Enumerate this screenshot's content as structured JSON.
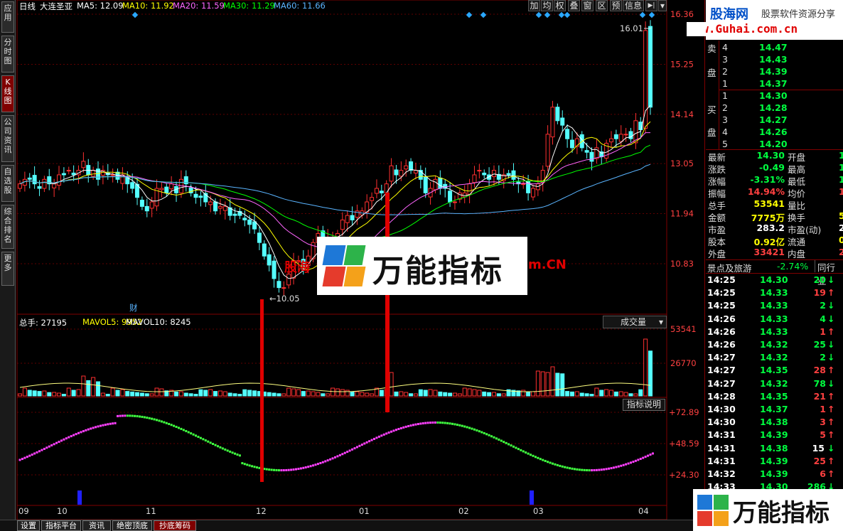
{
  "kline_header": {
    "period": "日线",
    "stock": "大连圣亚",
    "ma5": "MA5: 12.09",
    "ma10": "MA10: 11.92",
    "ma20": "MA20: 11.59",
    "ma30": "MA30: 11.29",
    "ma60": "MA60: 11.66"
  },
  "price_axis": [
    "16.36",
    "15.25",
    "14.14",
    "13.05",
    "11.94",
    "10.83"
  ],
  "price_marks": {
    "high": "16.01",
    "low": "10.05",
    "fin": "财"
  },
  "vol_header": {
    "total": "总手: 27195",
    "mavol5": "MAVOL5: 9952",
    "mavol10": "MAVOL10: 8245",
    "select": "成交量"
  },
  "vol_axis": [
    "53541",
    "26770"
  ],
  "ind_header": {
    "button": "指标说明"
  },
  "ind_axis": [
    "+72.89",
    "+48.59",
    "+24.30"
  ],
  "date_axis": [
    "09",
    "10",
    "11",
    "12",
    "01",
    "02",
    "03",
    "04"
  ],
  "left_tabs": [
    "应用",
    "分时图",
    "K线图",
    "公司资讯",
    "自选股",
    "综合排名",
    "更多"
  ],
  "toolbar": [
    "加",
    "均",
    "权",
    "叠",
    "窗",
    "区",
    "预",
    "信息"
  ],
  "watermarks": {
    "center_text": "万能指标",
    "center_bg_text": "股海",
    "center_suffix": "m.CN",
    "br_text": "万能指标",
    "tr_name": "股海网",
    "tr_slogan": "股票软件资源分享",
    "tr_url": "www.Guhai.com.cn"
  },
  "orderbook": {
    "sell_label": [
      "卖",
      "盘"
    ],
    "buy_label": [
      "买",
      "盘"
    ],
    "sell": [
      {
        "n": "4",
        "p": "14.47"
      },
      {
        "n": "3",
        "p": "14.43"
      },
      {
        "n": "2",
        "p": "14.39"
      },
      {
        "n": "1",
        "p": "14.37"
      }
    ],
    "buy": [
      {
        "n": "1",
        "p": "14.30"
      },
      {
        "n": "2",
        "p": "14.28"
      },
      {
        "n": "3",
        "p": "14.27"
      },
      {
        "n": "4",
        "p": "14.26"
      },
      {
        "n": "5",
        "p": "14.20"
      }
    ]
  },
  "quote": [
    {
      "l": "最新",
      "v": "14.30",
      "l2": "开盘",
      "v2": "1"
    },
    {
      "l": "涨跌",
      "v": "-0.49",
      "l2": "最高",
      "v2": "1"
    },
    {
      "l": "涨幅",
      "v": "-3.31%",
      "l2": "最低",
      "v2": "1"
    },
    {
      "l": "振幅",
      "v": "14.94%",
      "l2": "均价",
      "v2": "1"
    },
    {
      "l": "总手",
      "v": "53541",
      "l2": "量比",
      "v2": ""
    },
    {
      "l": "金额",
      "v": "7775万",
      "l2": "换手",
      "v2": "5"
    },
    {
      "l": "市盈",
      "v": "283.2",
      "l2": "市盈(动)",
      "v2": "2"
    },
    {
      "l": "股本",
      "v": "0.92亿",
      "l2": "流通",
      "v2": "0"
    },
    {
      "l": "外盘",
      "v": "33421",
      "l2": "内盘",
      "v2": "2"
    }
  ],
  "sector": {
    "name": "景点及旅游",
    "change": "-2.74%",
    "tab": "同行业"
  },
  "ticks": [
    {
      "t": "14:25",
      "p": "14.30",
      "v": "20",
      "d": "down"
    },
    {
      "t": "14:25",
      "p": "14.33",
      "v": "19",
      "d": "up"
    },
    {
      "t": "14:25",
      "p": "14.33",
      "v": "2",
      "d": "down"
    },
    {
      "t": "14:26",
      "p": "14.33",
      "v": "4",
      "d": "down"
    },
    {
      "t": "14:26",
      "p": "14.33",
      "v": "1",
      "d": "up"
    },
    {
      "t": "14:26",
      "p": "14.32",
      "v": "25",
      "d": "down"
    },
    {
      "t": "14:27",
      "p": "14.32",
      "v": "2",
      "d": "down"
    },
    {
      "t": "14:27",
      "p": "14.35",
      "v": "28",
      "d": "up"
    },
    {
      "t": "14:27",
      "p": "14.32",
      "v": "78",
      "d": "down"
    },
    {
      "t": "14:28",
      "p": "14.35",
      "v": "21",
      "d": "up"
    },
    {
      "t": "14:30",
      "p": "14.37",
      "v": "1",
      "d": "up"
    },
    {
      "t": "14:30",
      "p": "14.38",
      "v": "3",
      "d": "up"
    },
    {
      "t": "14:31",
      "p": "14.39",
      "v": "5",
      "d": "up"
    },
    {
      "t": "14:31",
      "p": "14.38",
      "v": "15",
      "d": "down"
    },
    {
      "t": "14:31",
      "p": "14.39",
      "v": "25",
      "d": "up"
    },
    {
      "t": "14:32",
      "p": "14.39",
      "v": "6",
      "d": "up"
    },
    {
      "t": "14:33",
      "p": "14.30",
      "v": "286",
      "d": "down"
    }
  ],
  "bottom_tabs": [
    "设置",
    "指标平台",
    "资讯",
    "绝密顶底",
    "抄底筹码"
  ],
  "chart_data": {
    "type": "candlestick",
    "close": [
      12.6,
      12.7,
      12.7,
      12.6,
      12.5,
      12.7,
      12.6,
      12.6,
      12.8,
      12.8,
      12.9,
      12.8,
      12.9,
      13.1,
      12.8,
      12.9,
      12.7,
      12.9,
      12.8,
      12.8,
      12.7,
      12.8,
      12.6,
      12.5,
      12.3,
      12.1,
      12.0,
      12.2,
      12.5,
      12.5,
      12.4,
      12.6,
      12.4,
      12.7,
      12.6,
      12.4,
      12.3,
      12.3,
      12.2,
      12.2,
      12.0,
      12.1,
      12.1,
      11.9,
      11.9,
      11.9,
      11.8,
      11.7,
      11.6,
      11.3,
      11.0,
      10.8,
      10.5,
      10.3,
      10.3,
      10.6,
      10.9,
      10.9,
      10.7,
      11.0,
      11.3,
      11.5,
      11.3,
      11.4,
      11.4,
      11.5,
      11.8,
      11.9,
      11.8,
      12.0,
      12.0,
      12.2,
      12.3,
      12.5,
      12.4,
      12.6,
      13.0,
      12.8,
      12.9,
      13.0,
      12.9,
      12.9,
      12.7,
      12.4,
      12.5,
      12.7,
      12.5,
      12.5,
      12.2,
      12.2,
      12.4,
      12.4,
      12.6,
      12.8,
      12.9,
      12.8,
      12.7,
      12.9,
      12.7,
      12.8,
      12.8,
      12.7,
      12.6,
      12.6,
      12.4,
      12.5,
      12.6,
      12.9,
      13.7,
      14.3,
      14.0,
      13.9,
      13.6,
      13.4,
      13.6,
      13.4,
      13.3,
      13.1,
      13.4,
      13.2,
      13.5,
      13.6,
      13.6,
      13.7,
      13.7,
      13.6,
      14.0,
      13.8,
      16.0,
      14.3
    ],
    "low": "10.05",
    "high": "16.01"
  }
}
